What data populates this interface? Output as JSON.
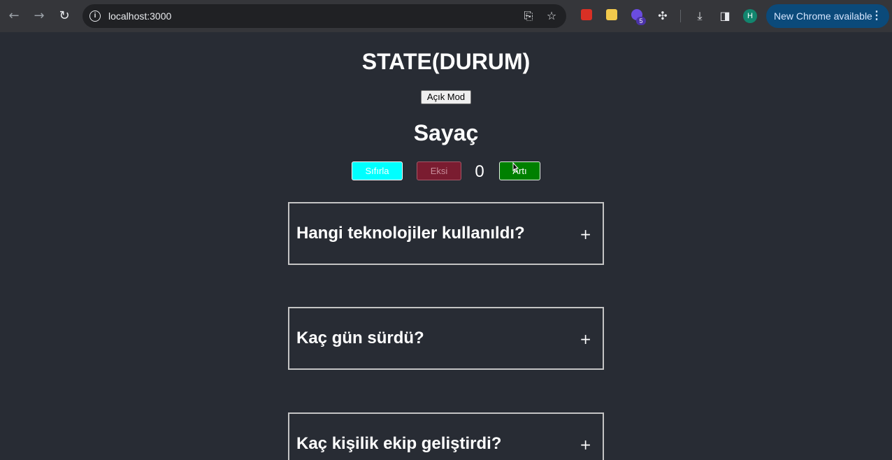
{
  "browser": {
    "url": "localhost:3000",
    "update_label": "New Chrome available",
    "profile_initial": "H",
    "extension_badge": "5"
  },
  "page": {
    "title": "STATE(DURUM)",
    "mode_button": "Açık Mod",
    "counter_title": "Sayaç",
    "reset_label": "Sıfırla",
    "minus_label": "Eksi",
    "count": "0",
    "plus_label": "Artı"
  },
  "faq": [
    {
      "question": "Hangi teknolojiler kullanıldı?",
      "toggle": "+"
    },
    {
      "question": "Kaç gün sürdü?",
      "toggle": "+"
    },
    {
      "question": "Kaç kişilik ekip geliştirdi?",
      "toggle": "+"
    }
  ],
  "colors": {
    "page_bg": "#282c34",
    "reset_bg": "#00ffff",
    "minus_bg": "#7a1c30",
    "plus_bg": "#008000",
    "update_pill_bg": "#0b4a7a"
  }
}
